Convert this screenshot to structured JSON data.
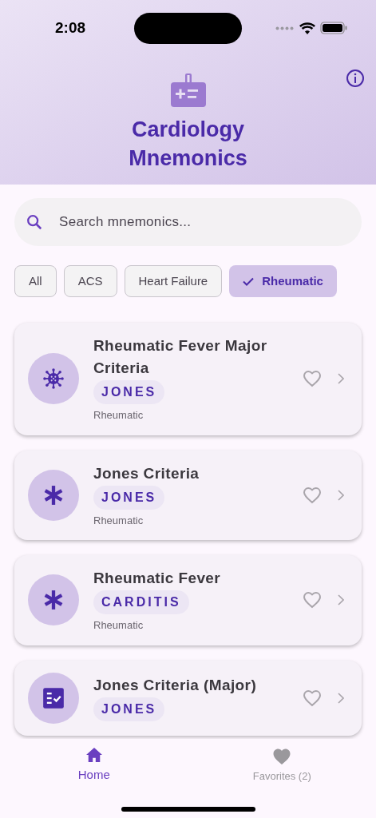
{
  "status_bar": {
    "time": "2:08"
  },
  "header": {
    "title": "Cardiology Mnemonics"
  },
  "search": {
    "placeholder": "Search mnemonics..."
  },
  "filters": [
    {
      "label": "All",
      "selected": false
    },
    {
      "label": "ACS",
      "selected": false
    },
    {
      "label": "Heart Failure",
      "selected": false
    },
    {
      "label": "Rheumatic",
      "selected": true
    }
  ],
  "cards": [
    {
      "kind": "virus",
      "title": "Rheumatic Fever Major Criteria",
      "tag": "JONES",
      "category": "Rheumatic",
      "favorite": false
    },
    {
      "kind": "asterisk",
      "title": "Jones Criteria",
      "tag": "JONES",
      "category": "Rheumatic",
      "favorite": false
    },
    {
      "kind": "asterisk",
      "title": "Rheumatic Fever",
      "tag": "CARDITIS",
      "category": "Rheumatic",
      "favorite": false
    },
    {
      "kind": "checklist",
      "title": "Jones Criteria (Major)",
      "tag": "JONES",
      "favorite": false
    }
  ],
  "nav": [
    {
      "kind": "home",
      "label": "Home",
      "selected": true
    },
    {
      "kind": "heart",
      "label": "Favorites (2)",
      "selected": false
    }
  ]
}
